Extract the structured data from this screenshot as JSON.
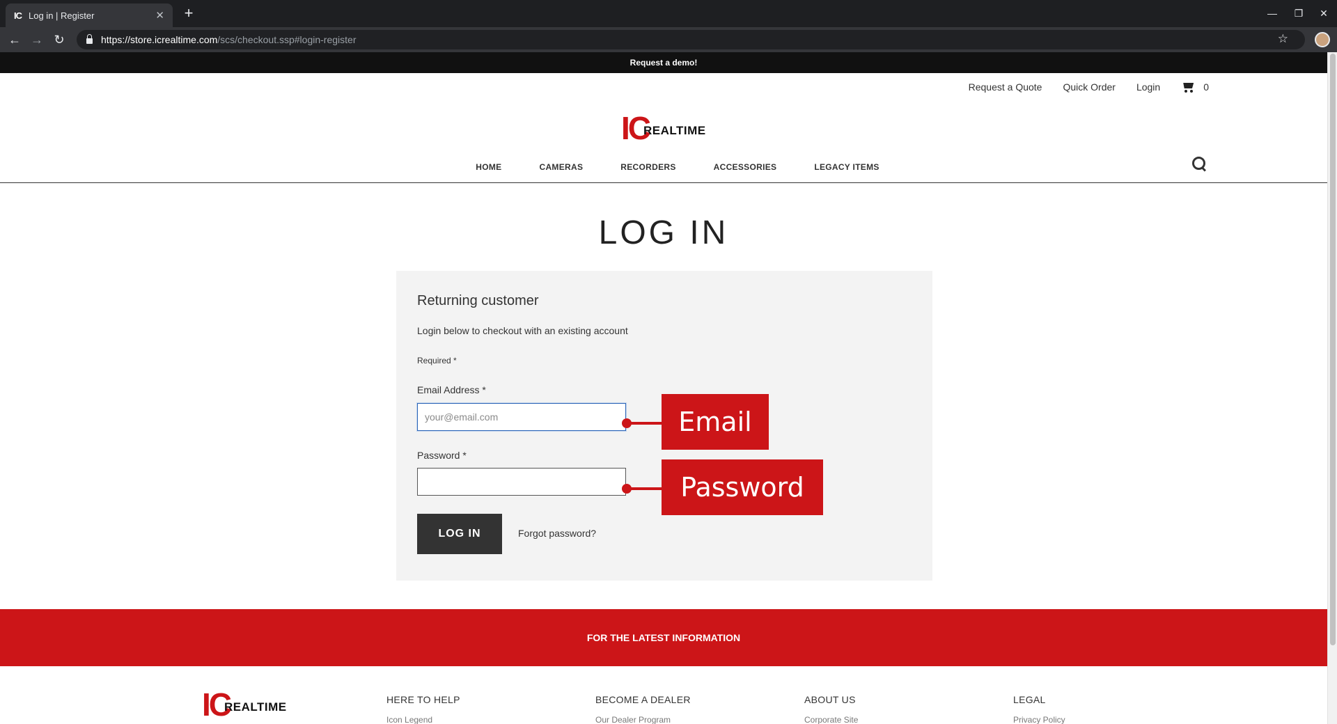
{
  "browser": {
    "tab_title": "Log in | Register",
    "tab_favicon": "IC",
    "tab_close": "✕",
    "new_tab": "+",
    "url_host": "https://store.icrealtime.com",
    "url_path": "/scs/checkout.ssp#login-register",
    "window_minimize": "—",
    "window_restore": "❐",
    "window_close": "✕",
    "back": "←",
    "forward": "→",
    "reload": "↻",
    "bookmark": "☆"
  },
  "banner": {
    "text": "Request a demo!"
  },
  "util_nav": {
    "items": [
      "Request a Quote",
      "Quick Order",
      "Login"
    ],
    "cart_count": "0"
  },
  "logo": {
    "ic": "IC",
    "realtime": "REALTIME"
  },
  "main_nav": {
    "items": [
      "HOME",
      "CAMERAS",
      "RECORDERS",
      "ACCESSORIES",
      "LEGACY ITEMS"
    ]
  },
  "page": {
    "title": "LOG IN"
  },
  "login": {
    "heading": "Returning customer",
    "description": "Login below to checkout with an existing account",
    "required_note": "Required *",
    "email_label": "Email Address *",
    "email_placeholder": "your@email.com",
    "email_value": "",
    "password_label": "Password *",
    "password_value": "",
    "submit_label": "LOG IN",
    "forgot_label": "Forgot password?"
  },
  "callouts": {
    "email": "Email",
    "password": "Password"
  },
  "band": {
    "text": "FOR THE LATEST INFORMATION"
  },
  "footer": {
    "columns": [
      {
        "heading": "HERE TO HELP",
        "first_link": "Icon Legend"
      },
      {
        "heading": "BECOME A DEALER",
        "first_link": "Our Dealer Program"
      },
      {
        "heading": "ABOUT US",
        "first_link": "Corporate Site"
      },
      {
        "heading": "LEGAL",
        "first_link": "Privacy Policy"
      }
    ]
  },
  "colors": {
    "brand_red": "#cc1518",
    "dark": "#333333",
    "card_bg": "#f3f3f3"
  }
}
